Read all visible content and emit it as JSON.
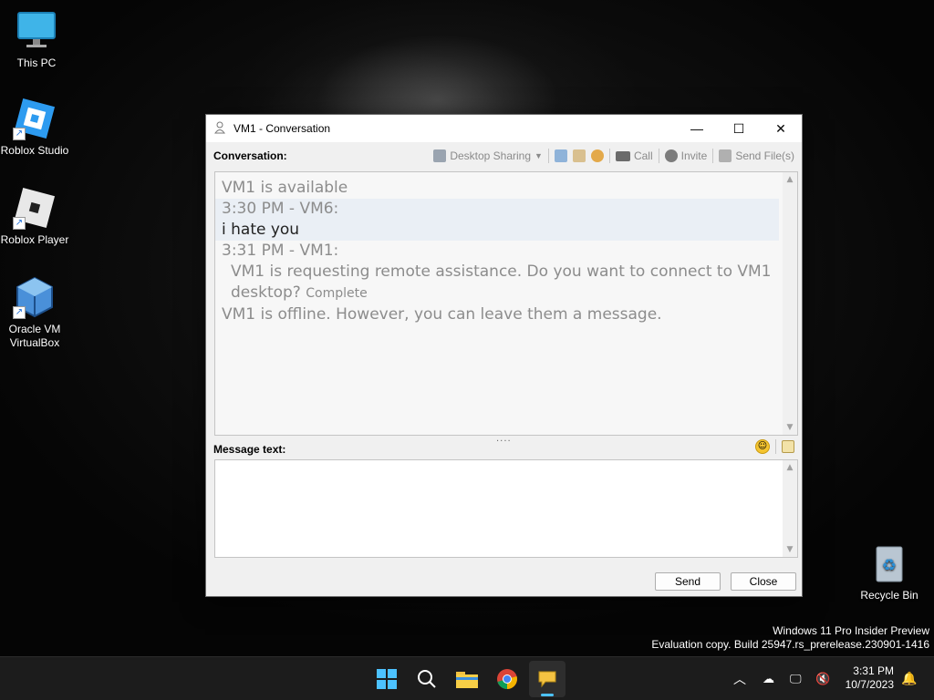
{
  "desktop": {
    "icons": [
      {
        "label": "This PC",
        "icon": "monitor-icon"
      },
      {
        "label": "Roblox Studio",
        "icon": "roblox-studio-icon"
      },
      {
        "label": "Roblox Player",
        "icon": "roblox-player-icon"
      },
      {
        "label": "Oracle VM VirtualBox",
        "icon": "virtualbox-icon"
      }
    ],
    "recycle_bin": "Recycle Bin",
    "watermark_line1": "Windows 11 Pro Insider Preview",
    "watermark_line2": "Evaluation copy. Build 25947.rs_prerelease.230901-1416"
  },
  "window": {
    "title": "VM1 - Conversation",
    "conversation_label": "Conversation:",
    "toolbar": {
      "desktop_sharing": "Desktop Sharing",
      "call": "Call",
      "invite": "Invite",
      "send_files": "Send File(s)"
    },
    "conversation": {
      "status_available": "VM1 is available",
      "msg1_header": "3:30 PM - VM6:",
      "msg1_text": "i hate you",
      "msg2_header": "3:31 PM - VM1:",
      "msg2_text_line1": "VM1 is requesting remote assistance. Do you want to connect to VM1",
      "msg2_text_line2": "desktop?",
      "msg2_status": "Complete",
      "status_offline": "VM1 is offline. However, you can leave them a message."
    },
    "message_label": "Message text:",
    "message_value": "",
    "send_button": "Send",
    "close_button": "Close"
  },
  "taskbar": {
    "time": "3:31 PM",
    "date": "10/7/2023",
    "apps": [
      "start-icon",
      "search-icon",
      "file-explorer-icon",
      "chrome-icon",
      "messenger-icon"
    ]
  },
  "colors": {
    "accent": "#1e6fd9",
    "window_bg": "#f0f0f0",
    "taskbar_bg": "#1c1c1c"
  }
}
